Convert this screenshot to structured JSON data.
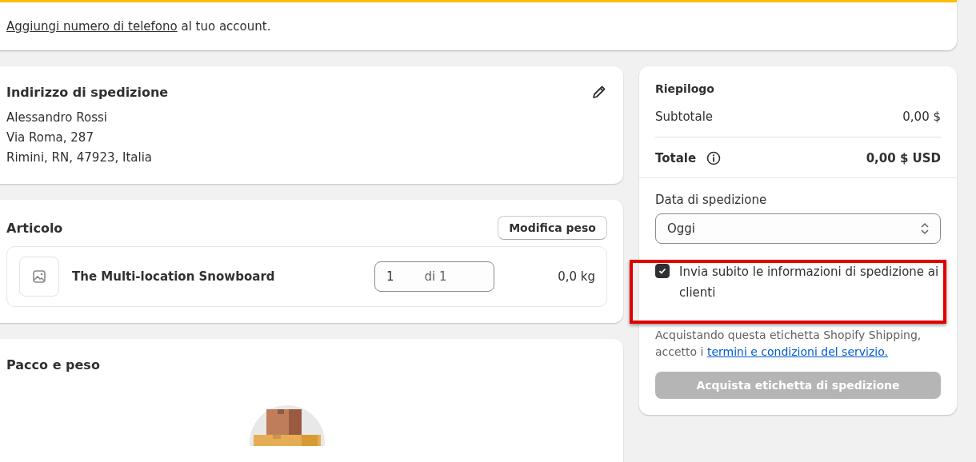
{
  "banner": {
    "link": "Aggiungi numero di telefono",
    "text": "al tuo account."
  },
  "shipping_address": {
    "title": "Indirizzo di spedizione",
    "lines": [
      "Alessandro Rossi",
      "Via Roma, 287",
      "Rimini, RN, 47923, Italia"
    ]
  },
  "items": {
    "title": "Articolo",
    "button": "Modifica peso",
    "rows": [
      {
        "name": "The Multi-location Snowboard",
        "quantity": "1",
        "of": "di 1",
        "weight": "0,0 kg"
      }
    ]
  },
  "package": {
    "title": "Pacco e peso"
  },
  "summary": {
    "title": "Riepilogo",
    "subtotal_label": "Subtotale",
    "subtotal": "0,00 $",
    "total_label": "Totale",
    "total": "0,00 $ USD",
    "date_label": "Data di spedizione",
    "date_value": "Oggi",
    "notify": {
      "label": "Invia subito le informazioni di spedizione ai clienti",
      "checked": true,
      "highlighted": true
    },
    "legal_text": "Acquistando questa etichetta Shopify Shipping, accetto i",
    "legal_link": "termini e condizioni del servizio.",
    "buy_button": {
      "label": "Acquista etichetta di spedizione",
      "disabled": true
    }
  }
}
